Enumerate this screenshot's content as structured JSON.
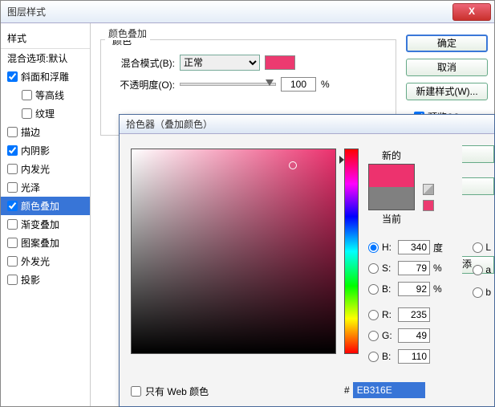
{
  "window": {
    "title": "图层样式"
  },
  "buttons": {
    "ok": "确定",
    "cancel": "取消",
    "newstyle": "新建样式(W)...",
    "preview_label": "预览(V)",
    "close_x": "X"
  },
  "left": {
    "header": "样式",
    "blend_defaults": "混合选项:默认",
    "items": [
      {
        "label": "斜面和浮雕",
        "checked": true
      },
      {
        "label": "等高线",
        "checked": false,
        "sub": true
      },
      {
        "label": "纹理",
        "checked": false,
        "sub": true
      },
      {
        "label": "描边",
        "checked": false
      },
      {
        "label": "内阴影",
        "checked": true
      },
      {
        "label": "内发光",
        "checked": false
      },
      {
        "label": "光泽",
        "checked": false
      },
      {
        "label": "颜色叠加",
        "checked": true,
        "selected": true
      },
      {
        "label": "渐变叠加",
        "checked": false
      },
      {
        "label": "图案叠加",
        "checked": false
      },
      {
        "label": "外发光",
        "checked": false
      },
      {
        "label": "投影",
        "checked": false
      }
    ]
  },
  "overlay": {
    "panel_title": "颜色叠加",
    "group_title": "颜色",
    "blend_label": "混合模式(B):",
    "blend_value": "正常",
    "opacity_label": "不透明度(O):",
    "opacity_value": "100",
    "opacity_unit": "%"
  },
  "picker": {
    "title": "拾色器（叠加颜色）",
    "new_label": "新的",
    "current_label": "当前",
    "webonly_label": "只有 Web 颜色",
    "hash": "#",
    "hex": "EB316E",
    "channels": {
      "H": {
        "value": "340",
        "unit": "度"
      },
      "S": {
        "value": "79",
        "unit": "%"
      },
      "B": {
        "value": "92",
        "unit": "%"
      },
      "R": {
        "value": "235",
        "unit": ""
      },
      "G": {
        "value": "49",
        "unit": ""
      },
      "Bb": {
        "value": "110",
        "unit": ""
      }
    },
    "labels": {
      "H": "H:",
      "S": "S:",
      "B": "B:",
      "R": "R:",
      "G": "G:",
      "Bb": "B:"
    },
    "extra": {
      "L": "L",
      "a": "a",
      "b": "b"
    },
    "add_btn": "添"
  },
  "colors": {
    "overlay_swatch": "#ec3a70",
    "new_color": "#ed326e",
    "current_color": "#808080"
  }
}
